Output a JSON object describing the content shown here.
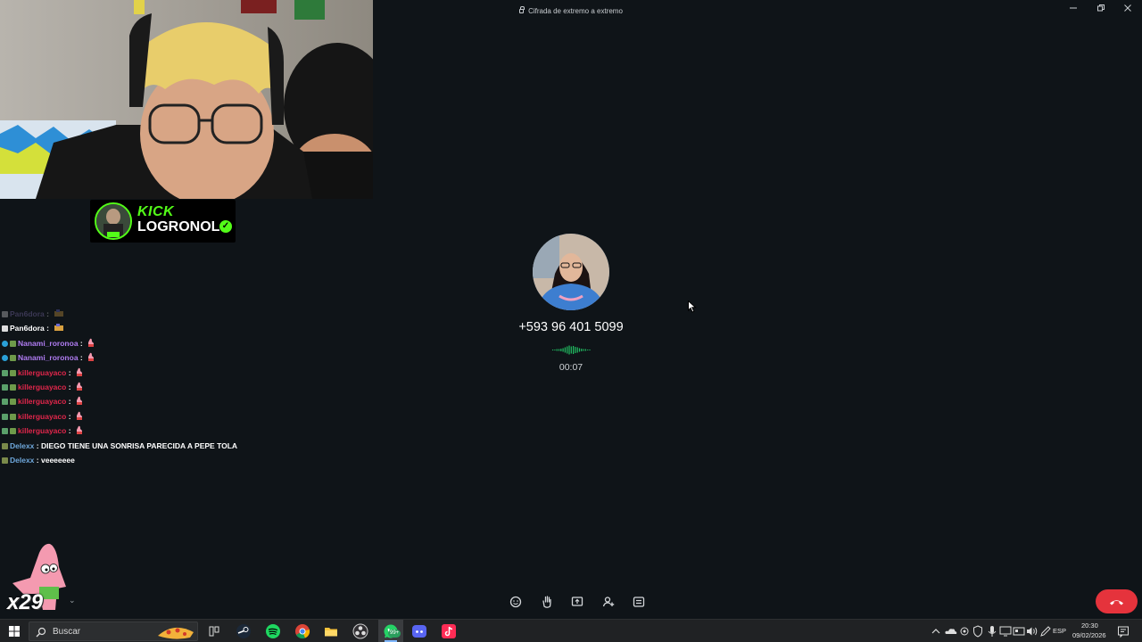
{
  "titlebar": {
    "encryption_text": "Cifrada de extremo a extremo"
  },
  "kick": {
    "brand": "KICK",
    "channel": "LOGRONOL"
  },
  "chat": {
    "messages": [
      {
        "user": "Pan6dora",
        "text": "",
        "user_color": "#8a78c0",
        "faded": true
      },
      {
        "user": "Pan6dora",
        "text": "",
        "user_color": "#ffffff"
      },
      {
        "user": "Nanami_roronoa",
        "text": "",
        "user_color": "#b07cf2"
      },
      {
        "user": "Nanami_roronoa",
        "text": "",
        "user_color": "#b07cf2"
      },
      {
        "user": "killerguayaco",
        "text": "",
        "user_color": "#e0264b"
      },
      {
        "user": "killerguayaco",
        "text": "",
        "user_color": "#e0264b"
      },
      {
        "user": "killerguayaco",
        "text": "",
        "user_color": "#e0264b"
      },
      {
        "user": "killerguayaco",
        "text": "",
        "user_color": "#e0264b"
      },
      {
        "user": "killerguayaco",
        "text": "",
        "user_color": "#e0264b"
      },
      {
        "user": "Delexx",
        "text": "DIEGO TIENE UNA SONRISA PARECIDA A PEPE TOLA",
        "user_color": "#6fa8dc"
      },
      {
        "user": "Delexx",
        "text": "veeeeeee",
        "user_color": "#6fa8dc"
      }
    ]
  },
  "call": {
    "number": "+593 96 401 5099",
    "timer": "00:07",
    "wave_color": "#21c063",
    "end_color": "#e5333c"
  },
  "overlay": {
    "tag": "x29"
  },
  "taskbar": {
    "search_placeholder": "Buscar",
    "whatsapp_badge": "99+",
    "language": "ESP",
    "time": "20:30",
    "date": "09/02/2026"
  }
}
